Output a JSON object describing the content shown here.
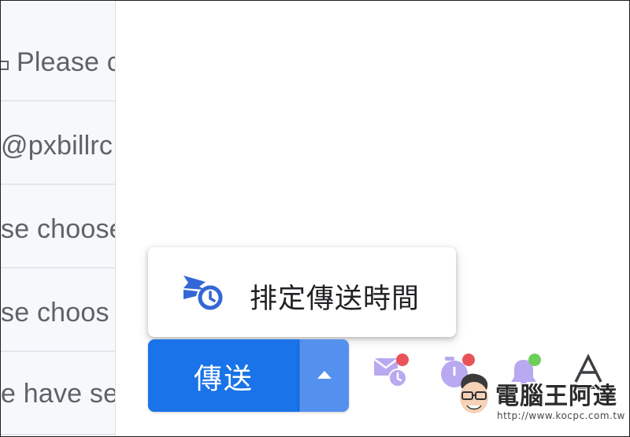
{
  "mail_list": {
    "rows": [
      {
        "snippet": "Please c",
        "has_icon": true
      },
      {
        "snippet": "@pxbillrc",
        "has_icon": false
      },
      {
        "snippet": "se choose",
        "has_icon": false
      },
      {
        "snippet": "se choos",
        "has_icon": false
      },
      {
        "snippet": "e have se",
        "has_icon": false
      }
    ]
  },
  "popup": {
    "item_label": "排定傳送時間",
    "item_icon": "schedule-send-icon"
  },
  "send": {
    "label": "傳送",
    "dropdown_icon": "caret-up-icon"
  },
  "toolbar": {
    "icons": [
      "scheduled-mail-icon",
      "timer-icon",
      "bell-icon",
      "text-format-icon"
    ]
  },
  "watermark": {
    "title": "電腦王阿達",
    "url": "http://www.kocpc.com.tw"
  },
  "colors": {
    "primary": "#1a73e8",
    "primary_light": "#5490ee",
    "icon_purple": "#b8a9f0",
    "badge_red": "#e8535a",
    "badge_green": "#6ccf5a",
    "text_muted": "#5f6368"
  }
}
